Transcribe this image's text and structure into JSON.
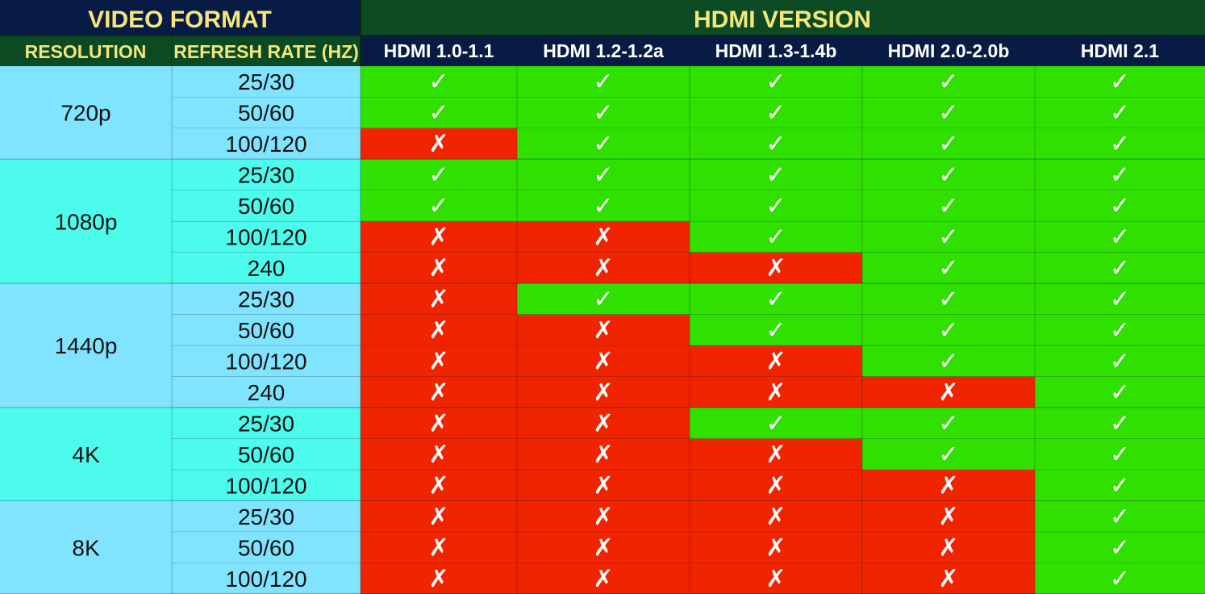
{
  "header": {
    "group_left": "VIDEO FORMAT",
    "group_right": "HDMI VERSION",
    "col_resolution": "RESOLUTION",
    "col_refresh": "REFRESH RATE (HZ)",
    "versions": [
      "HDMI 1.0-1.1",
      "HDMI 1.2-1.2a",
      "HDMI 1.3-1.4b",
      "HDMI 2.0-2.0b",
      "HDMI 2.1"
    ]
  },
  "symbols": {
    "supported": "✓",
    "unsupported": "✗"
  },
  "colors": {
    "page_background": "#071130",
    "header_dark": "#071b44",
    "header_green": "#0b4a23",
    "header_text": "#f4e67a",
    "supported": "#2fe000",
    "unsupported": "#f02400",
    "res_band_a": "#80e4ff",
    "res_band_b": "#4cfbec"
  },
  "groups": [
    {
      "resolution": "720p",
      "rows": [
        {
          "rate": "25/30",
          "support": [
            1,
            1,
            1,
            1,
            1
          ]
        },
        {
          "rate": "50/60",
          "support": [
            1,
            1,
            1,
            1,
            1
          ]
        },
        {
          "rate": "100/120",
          "support": [
            0,
            1,
            1,
            1,
            1
          ]
        }
      ]
    },
    {
      "resolution": "1080p",
      "rows": [
        {
          "rate": "25/30",
          "support": [
            1,
            1,
            1,
            1,
            1
          ]
        },
        {
          "rate": "50/60",
          "support": [
            1,
            1,
            1,
            1,
            1
          ]
        },
        {
          "rate": "100/120",
          "support": [
            0,
            0,
            1,
            1,
            1
          ]
        },
        {
          "rate": "240",
          "support": [
            0,
            0,
            0,
            1,
            1
          ]
        }
      ]
    },
    {
      "resolution": "1440p",
      "rows": [
        {
          "rate": "25/30",
          "support": [
            0,
            1,
            1,
            1,
            1
          ]
        },
        {
          "rate": "50/60",
          "support": [
            0,
            0,
            1,
            1,
            1
          ]
        },
        {
          "rate": "100/120",
          "support": [
            0,
            0,
            0,
            1,
            1
          ]
        },
        {
          "rate": "240",
          "support": [
            0,
            0,
            0,
            0,
            1
          ]
        }
      ]
    },
    {
      "resolution": "4K",
      "rows": [
        {
          "rate": "25/30",
          "support": [
            0,
            0,
            1,
            1,
            1
          ]
        },
        {
          "rate": "50/60",
          "support": [
            0,
            0,
            0,
            1,
            1
          ]
        },
        {
          "rate": "100/120",
          "support": [
            0,
            0,
            0,
            0,
            1
          ]
        }
      ]
    },
    {
      "resolution": "8K",
      "rows": [
        {
          "rate": "25/30",
          "support": [
            0,
            0,
            0,
            0,
            1
          ]
        },
        {
          "rate": "50/60",
          "support": [
            0,
            0,
            0,
            0,
            1
          ]
        },
        {
          "rate": "100/120",
          "support": [
            0,
            0,
            0,
            0,
            1
          ]
        }
      ]
    }
  ]
}
